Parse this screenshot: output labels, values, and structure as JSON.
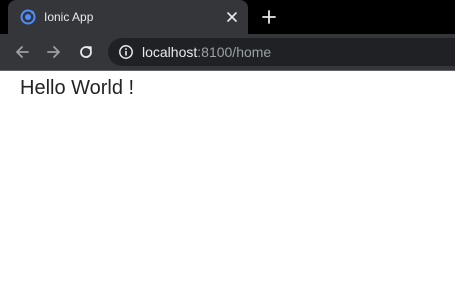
{
  "tab": {
    "title": "Ionic App",
    "favicon": "ionic-logo-icon",
    "close_icon": "close-icon"
  },
  "new_tab_icon": "plus-icon",
  "toolbar": {
    "back_icon": "arrow-left-icon",
    "forward_icon": "arrow-right-icon",
    "reload_icon": "reload-icon",
    "info_icon": "info-icon",
    "url_host": "localhost",
    "url_rest": ":8100/home"
  },
  "page": {
    "greeting": "Hello World !"
  },
  "colors": {
    "accent": "#4c8dff",
    "tab_bar": "#000000",
    "toolbar": "#35363a",
    "omnibox": "#202124"
  }
}
